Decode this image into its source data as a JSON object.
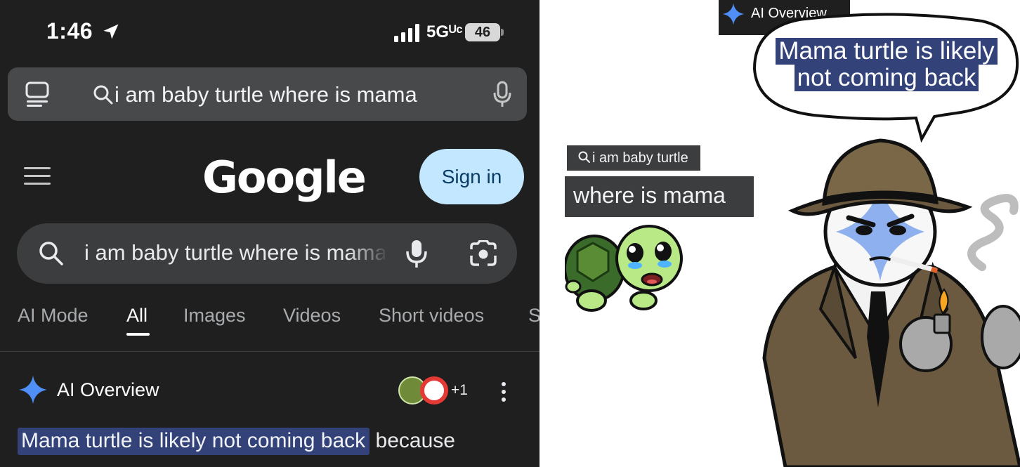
{
  "phone": {
    "status": {
      "time": "1:46",
      "network": "5Gᵁᶜ",
      "battery": "46"
    },
    "url_bar": {
      "query": "i am baby turtle where is mama"
    },
    "header": {
      "logo": "Google",
      "sign_in": "Sign in"
    },
    "search": {
      "query": "i am baby turtle where is mama"
    },
    "tabs": [
      {
        "label": "AI Mode",
        "active": false
      },
      {
        "label": "All",
        "active": true
      },
      {
        "label": "Images",
        "active": false
      },
      {
        "label": "Videos",
        "active": false
      },
      {
        "label": "Short videos",
        "active": false
      },
      {
        "label": "S",
        "active": false
      }
    ],
    "ai_overview": {
      "title": "AI Overview",
      "sources_count": "+1",
      "answer_highlight": "Mama turtle is likely not coming back",
      "answer_rest": "because"
    }
  },
  "meme": {
    "tag": "AI Overview",
    "speech_line1": "Mama turtle is likely",
    "speech_line2": "not coming back",
    "query_small": "i am baby turtle",
    "query_big": "where is mama"
  },
  "colors": {
    "dark_bg": "#1f1f1f",
    "search_bg": "#3c3d3f",
    "sign_in_bg": "#c2e7ff",
    "highlight": "#33437a",
    "sparkle_blue": "#4f8ff7"
  },
  "icons": [
    "location-arrow-icon",
    "signal-icon",
    "battery-icon",
    "tabs-icon",
    "search-icon",
    "mic-icon",
    "lens-icon",
    "hamburger-icon",
    "sparkle-icon",
    "more-vert-icon"
  ]
}
